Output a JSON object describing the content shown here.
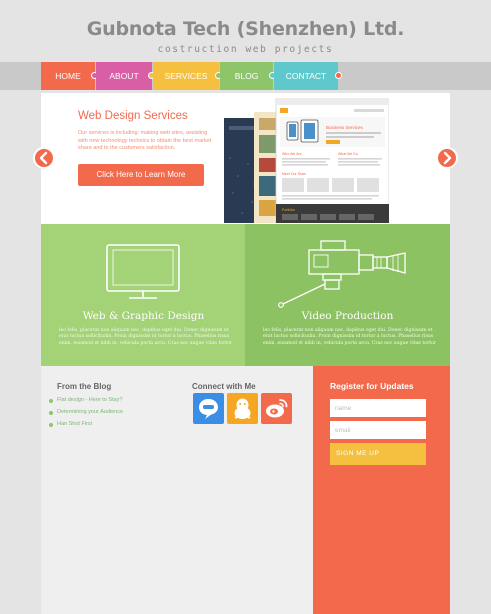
{
  "header": {
    "title": "Gubnota Tech (Shenzhen) Ltd.",
    "tagline": "costruction web projects"
  },
  "nav": {
    "items": [
      {
        "label": "HOME",
        "color": "#f26a4b"
      },
      {
        "label": "ABOUT",
        "color": "#d85fa6"
      },
      {
        "label": "SERVICES",
        "color": "#f5bf3f"
      },
      {
        "label": "BLOG",
        "color": "#8fc56a"
      },
      {
        "label": "CONTACT",
        "color": "#5ec8cc"
      }
    ]
  },
  "slider": {
    "heading": "Web Design Services",
    "text": "Our services is including: making web sites, assisting with new technology technics to obtain the best market share and to the customers satisfaction.",
    "cta_label": "Click Here to Learn More",
    "active_slide": 1,
    "slide_count": 4,
    "mockup": {
      "site_heading": "Business Services",
      "card_1": "Who We Are",
      "card_2": "What We Do",
      "card_3": "Meet Our Team",
      "card_4": "Portfolio"
    }
  },
  "services": [
    {
      "title": "Web & Graphic Design",
      "icon": "monitor-icon",
      "text": "leo felis, placerat non aliquam nec, dapibus eget dui. Donec dignissim et erat luctus sollicitudin. Proin dignissim id tortor a luctus. Phasellus risus enim, euismod et nibh in, vehicula porta arcu. Cras nec augue vitae tortor",
      "color": "#a3d277"
    },
    {
      "title": "Video Production",
      "icon": "video-camera-icon",
      "text": "leo felis, placerat non aliquam nec, dapibus eget dui. Donec dignissim et erat luctus sollicitudin. Proin dignissim id tortor a luctus. Phasellus risus enim, euismod et nibh in, vehicula porta arcu. Cras nec augue vitae tortor",
      "color": "#8dc262"
    }
  ],
  "blog": {
    "heading": "From the Blog",
    "posts": [
      "Flat design - Here to Stay?",
      "Determining your Audience",
      "Han Shot First"
    ]
  },
  "connect": {
    "heading": "Connect with Me",
    "networks": [
      {
        "icon": "speech-bubble-icon",
        "color": "#3a8ee6"
      },
      {
        "icon": "penguin-icon",
        "color": "#f5a623"
      },
      {
        "icon": "weibo-icon",
        "color": "#f26a4b"
      }
    ]
  },
  "register": {
    "heading": "Register for Updates",
    "name_placeholder": "name",
    "email_placeholder": "email",
    "submit_label": "SIGN ME UP"
  }
}
